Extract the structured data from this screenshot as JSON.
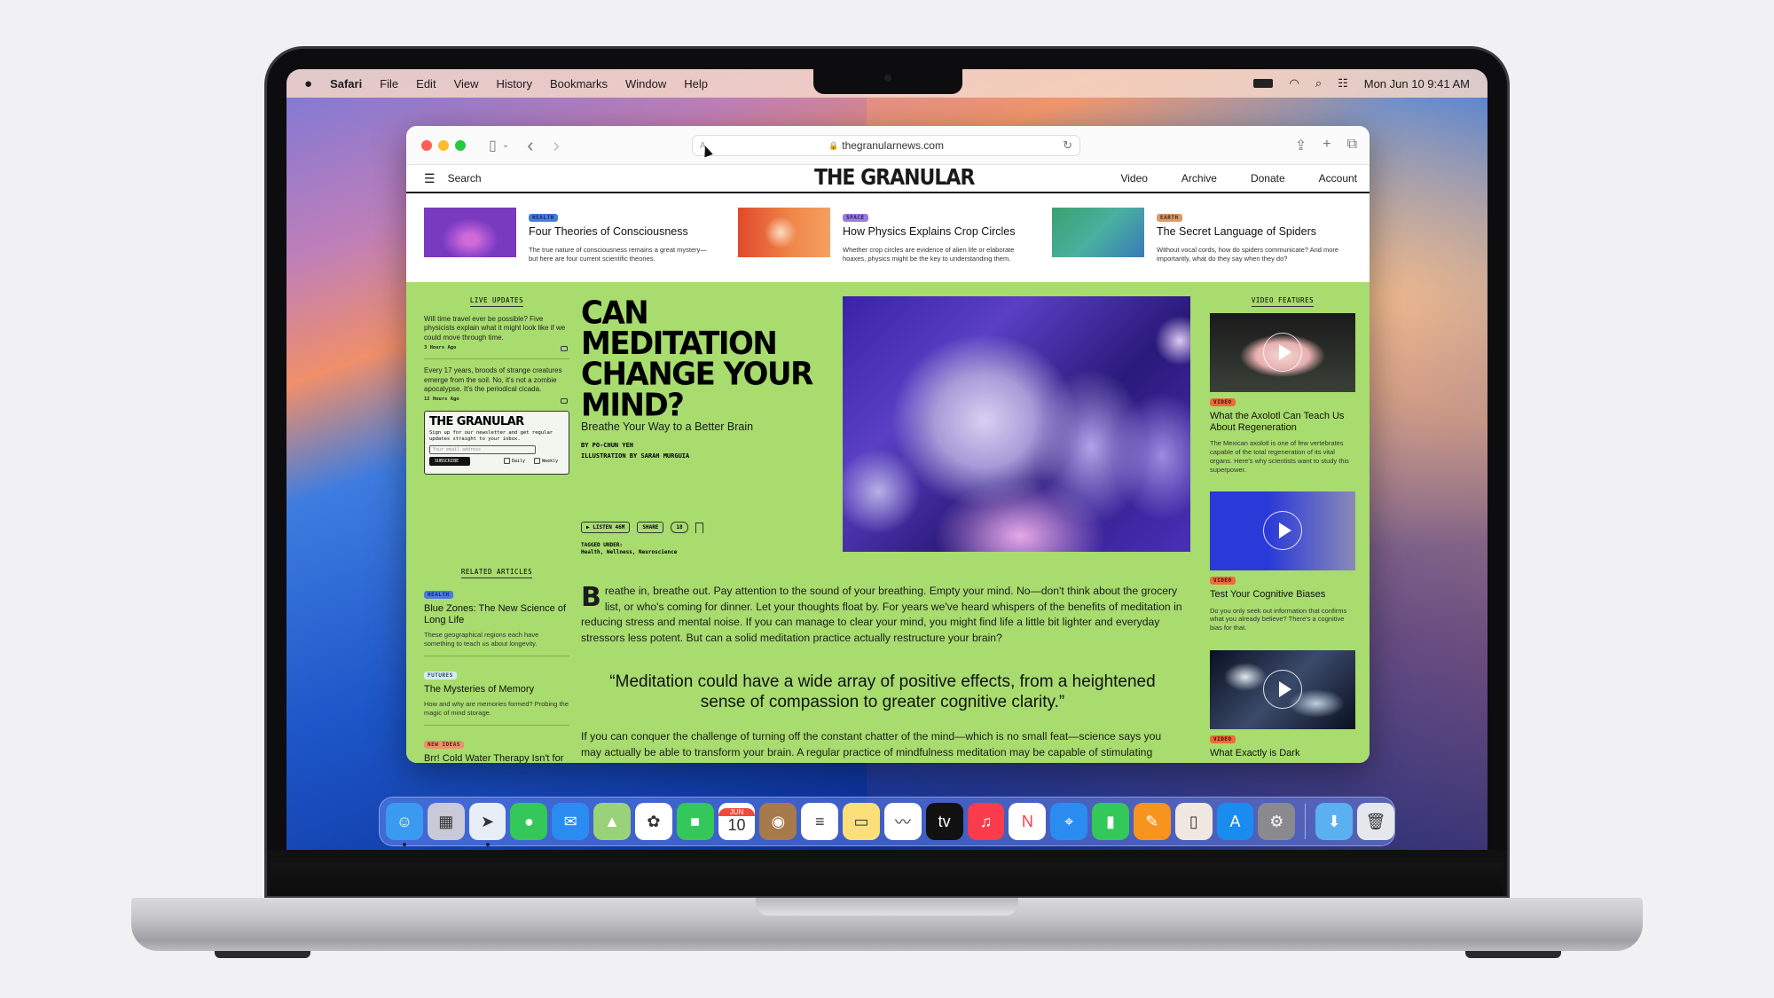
{
  "menubar": {
    "app_name": "Safari",
    "items": [
      "File",
      "Edit",
      "View",
      "History",
      "Bookmarks",
      "Window",
      "Help"
    ],
    "clock": "Mon Jun 10  9:41 AM",
    "status_icons": [
      "battery-icon",
      "wifi-icon",
      "spotlight-search-icon",
      "control-center-icon"
    ]
  },
  "browser": {
    "url": "thegranularnews.com",
    "reader_glyph": "A",
    "icons": {
      "sidebar": "▯",
      "back": "‹",
      "forward": "›",
      "reload": "↻",
      "share": "⇪",
      "new_tab": "+",
      "tabs": "⧉"
    }
  },
  "site": {
    "logo": "THE GRANULAR",
    "menu_glyph": "☰",
    "search_label": "Search",
    "nav_links": [
      "Video",
      "Archive",
      "Donate",
      "Account"
    ]
  },
  "trending": [
    {
      "tag": "HEALTH",
      "tag_color": "#4a7be0",
      "title": "Four Theories of Consciousness",
      "desc": "The true nature of consciousness remains a great mystery—but here are four current scientific theories."
    },
    {
      "tag": "SPACE",
      "tag_color": "#9b7be0",
      "title": "How Physics Explains Crop Circles",
      "desc": "Whether crop circles are evidence of alien life or elaborate hoaxes, physics might be the key to understanding them."
    },
    {
      "tag": "EARTH",
      "tag_color": "#d89a6a",
      "title": "The Secret Language of Spiders",
      "desc": "Without vocal cords, how do spiders communicate? And more importantly, what do they say when they do?"
    }
  ],
  "live_updates": {
    "heading": "LIVE UPDATES",
    "items": [
      {
        "text": "Will time travel ever be possible? Five physicists explain what it might look like if we could move through time.",
        "ago": "3 Hours Ago"
      },
      {
        "text": "Every 17 years, broods of strange creatures emerge from the soil. No, it's not a zombie apocalypse. It's the periodical cicada.",
        "ago": "12 Hours Ago"
      }
    ]
  },
  "newsletter": {
    "logo": "THE GRANULAR",
    "text": "Sign up for our newsletter and get regular updates straight to your inbox.",
    "placeholder": "Your email address",
    "subscribe": "SUBSCRIBE",
    "options": [
      "Daily",
      "Weekly"
    ]
  },
  "related": {
    "heading": "RELATED ARTICLES",
    "items": [
      {
        "tag": "HEALTH",
        "tag_color": "#4a7be0",
        "title": "Blue Zones: The New Science of Long Life",
        "desc": "These geographical regions each have something to teach us about longevity."
      },
      {
        "tag": "FUTURES",
        "tag_color": "#d6ecf4",
        "title": "The Mysteries of Memory",
        "desc": "How and why are memories formed? Probing the magic of mind storage."
      },
      {
        "tag": "NEW IDEAS",
        "tag_color": "#e8936a",
        "title": "Brr! Cold Water Therapy Isn't for Everyone",
        "desc": ""
      }
    ]
  },
  "article": {
    "headline": "CAN MEDITATION CHANGE YOUR MIND?",
    "subhead": "Breathe Your Way to a Better Brain",
    "byline": "BY PO-CHUN YEH",
    "illustration": "ILLUSTRATION BY SARAH MURGUIA",
    "listen": "LISTEN 46M",
    "share": "SHARE",
    "comments": "18",
    "tagged_label": "TAGGED UNDER:",
    "tags": "Health, Wellness, Neuroscience",
    "dropcap": "B",
    "body1": "reathe in, breathe out. Pay attention to the sound of your breathing. Empty your mind. No—don't think about the grocery list, or who's coming for dinner. Let your thoughts float by. For years we've heard whispers of the benefits of meditation in reducing stress and mental noise. If you can manage to clear your mind, you might find life a little bit lighter and everyday stressors less potent. But can a solid meditation practice actually restructure your brain?",
    "quote": "“Meditation could have a wide array of positive effects, from a heightened sense of compassion to greater cognitive clarity.”",
    "body2": "If you can conquer the challenge of turning off the constant chatter of the mind—which is no small feat—science says you may actually be able to transform your brain. A regular practice of mindfulness meditation may be capable of stimulating several major changes in the brain, effectively “rewiring” it in a process known as neuroplasticity. Here"
  },
  "video_features": {
    "heading": "VIDEO FEATURES",
    "badge": "VIDEO",
    "badge_color": "#f06a3a",
    "items": [
      {
        "title": "What the Axolotl Can Teach Us About Regeneration",
        "desc": "The Mexican axolotl is one of few vertebrates capable of the total regeneration of its vital organs. Here's why scientists want to study this superpower."
      },
      {
        "title": "Test Your Cognitive Biases",
        "desc": "Do you only seek out information that confirms what you already believe? There's a cognitive bias for that."
      },
      {
        "title": "What Exactly is Dark",
        "desc": ""
      }
    ]
  },
  "dock": {
    "apps": [
      {
        "name": "Finder",
        "glyph": "☺",
        "bg": "#3a9af0",
        "running": true
      },
      {
        "name": "Launchpad",
        "glyph": "▦",
        "bg": "#c9c9d8",
        "running": false
      },
      {
        "name": "Safari",
        "glyph": "➤",
        "bg": "#e8eef8",
        "running": true
      },
      {
        "name": "Messages",
        "glyph": "●",
        "bg": "#34c759",
        "running": false
      },
      {
        "name": "Mail",
        "glyph": "✉",
        "bg": "#2a8cf0",
        "running": false
      },
      {
        "name": "Maps",
        "glyph": "▲",
        "bg": "#9ad27a",
        "running": false
      },
      {
        "name": "Photos",
        "glyph": "✿",
        "bg": "#ffffff",
        "running": false
      },
      {
        "name": "FaceTime",
        "glyph": "■",
        "bg": "#34c759",
        "running": false
      },
      {
        "name": "Calendar",
        "glyph": "10",
        "bg": "#ffffff",
        "month": "JUN",
        "running": false
      },
      {
        "name": "Contacts",
        "glyph": "◉",
        "bg": "#a67a4a",
        "running": false
      },
      {
        "name": "Reminders",
        "glyph": "≡",
        "bg": "#ffffff",
        "running": false
      },
      {
        "name": "Notes",
        "glyph": "▭",
        "bg": "#fbe07a",
        "running": false
      },
      {
        "name": "Freeform",
        "glyph": "〰",
        "bg": "#ffffff",
        "running": false
      },
      {
        "name": "TV",
        "glyph": "tv",
        "bg": "#111111",
        "running": false
      },
      {
        "name": "Music",
        "glyph": "♫",
        "bg": "#fa3c4c",
        "running": false
      },
      {
        "name": "News",
        "glyph": "N",
        "bg": "#ffffff",
        "running": false
      },
      {
        "name": "Keynote",
        "glyph": "⌖",
        "bg": "#2a8cf0",
        "running": false
      },
      {
        "name": "Numbers",
        "glyph": "▮",
        "bg": "#34c759",
        "running": false
      },
      {
        "name": "Pages",
        "glyph": "✎",
        "bg": "#f7941d",
        "running": false
      },
      {
        "name": "iPhone Mirroring",
        "glyph": "▯",
        "bg": "#f0e8e0",
        "running": false
      },
      {
        "name": "App Store",
        "glyph": "A",
        "bg": "#1a8cf0",
        "running": false
      },
      {
        "name": "System Settings",
        "glyph": "⚙",
        "bg": "#8a8a8e",
        "running": false
      }
    ],
    "extras": [
      {
        "name": "Downloads",
        "glyph": "⬇",
        "bg": "#5ab0f0"
      },
      {
        "name": "Trash",
        "glyph": "🗑",
        "bg": "#e4e8ec"
      }
    ]
  }
}
